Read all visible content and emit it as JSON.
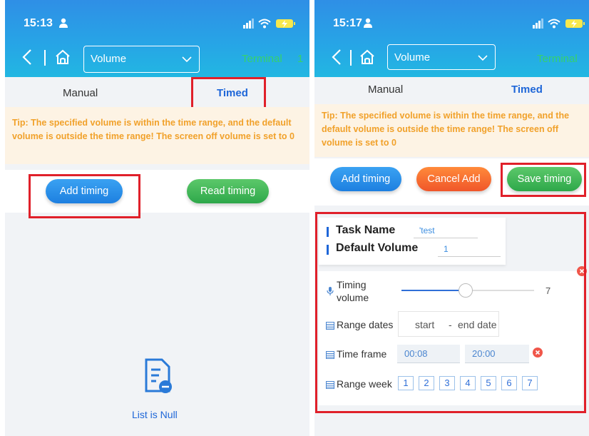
{
  "left": {
    "status_time": "15:13",
    "select_value": "Volume",
    "terminal_label": "Terminal",
    "terminal_suffix": "1",
    "tab_manual": "Manual",
    "tab_timed": "Timed",
    "tip": "Tip: The specified volume is within the time range, and the default volume is outside the time range! The screen off volume is set to 0",
    "add_timing": "Add timing",
    "read_timing": "Read timing",
    "empty_text": "List is Null"
  },
  "right": {
    "status_time": "15:17",
    "select_value": "Volume",
    "terminal_label": "Terminal",
    "tab_manual": "Manual",
    "tab_timed": "Timed",
    "tip": "Tip: The specified volume is within the time range, and the default volume is outside the time range! The screen off volume is set to 0",
    "add_timing": "Add timing",
    "cancel_add": "Cancel Add",
    "save_timing": "Save timing",
    "task_name_label": "Task Name",
    "task_name_value": "'test",
    "default_volume_label": "Default Volume",
    "default_volume_value": "1",
    "timing_volume_label_1": "Timing",
    "timing_volume_label_2": "volume",
    "timing_volume_value": "7",
    "timing_volume_level": 0.45,
    "range_dates_label": "Range dates",
    "range_start": "start",
    "range_dash": "-",
    "range_end": "end date",
    "time_frame_label": "Time frame",
    "time_start": "00:08",
    "time_end": "20:00",
    "range_week_label": "Range week",
    "week_days": [
      "1",
      "2",
      "3",
      "4",
      "5",
      "6",
      "7"
    ]
  },
  "colors": {
    "header_blue": "#2f8fe6",
    "accent_blue": "#1e66d8",
    "tip_orange": "#f1a12a",
    "tip_bg": "#fdf3e4",
    "pill_green": "#2ea84a",
    "pill_orange": "#f0562a",
    "highlight_red": "#e0202a",
    "terminal_green": "#36d16c"
  },
  "icons": [
    "person-icon",
    "signal-icon",
    "wifi-icon",
    "battery-charging-icon",
    "back-chevron-icon",
    "home-icon",
    "chevron-down-icon",
    "empty-document-icon",
    "microphone-icon",
    "calendar-icon",
    "clear-icon",
    "close-icon"
  ]
}
